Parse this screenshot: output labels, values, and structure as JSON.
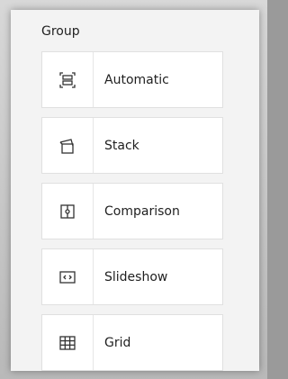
{
  "panel": {
    "title": "Group",
    "items": [
      {
        "label": "Automatic",
        "icon": "automatic-layout-icon"
      },
      {
        "label": "Stack",
        "icon": "stack-layout-icon"
      },
      {
        "label": "Comparison",
        "icon": "comparison-layout-icon"
      },
      {
        "label": "Slideshow",
        "icon": "slideshow-layout-icon"
      },
      {
        "label": "Grid",
        "icon": "grid-layout-icon"
      }
    ]
  },
  "colors": {
    "panel_background": "#f3f3f3",
    "item_background": "#ffffff",
    "border": "#e0e0e0",
    "text": "#1f1f1f",
    "icon": "#333333"
  }
}
